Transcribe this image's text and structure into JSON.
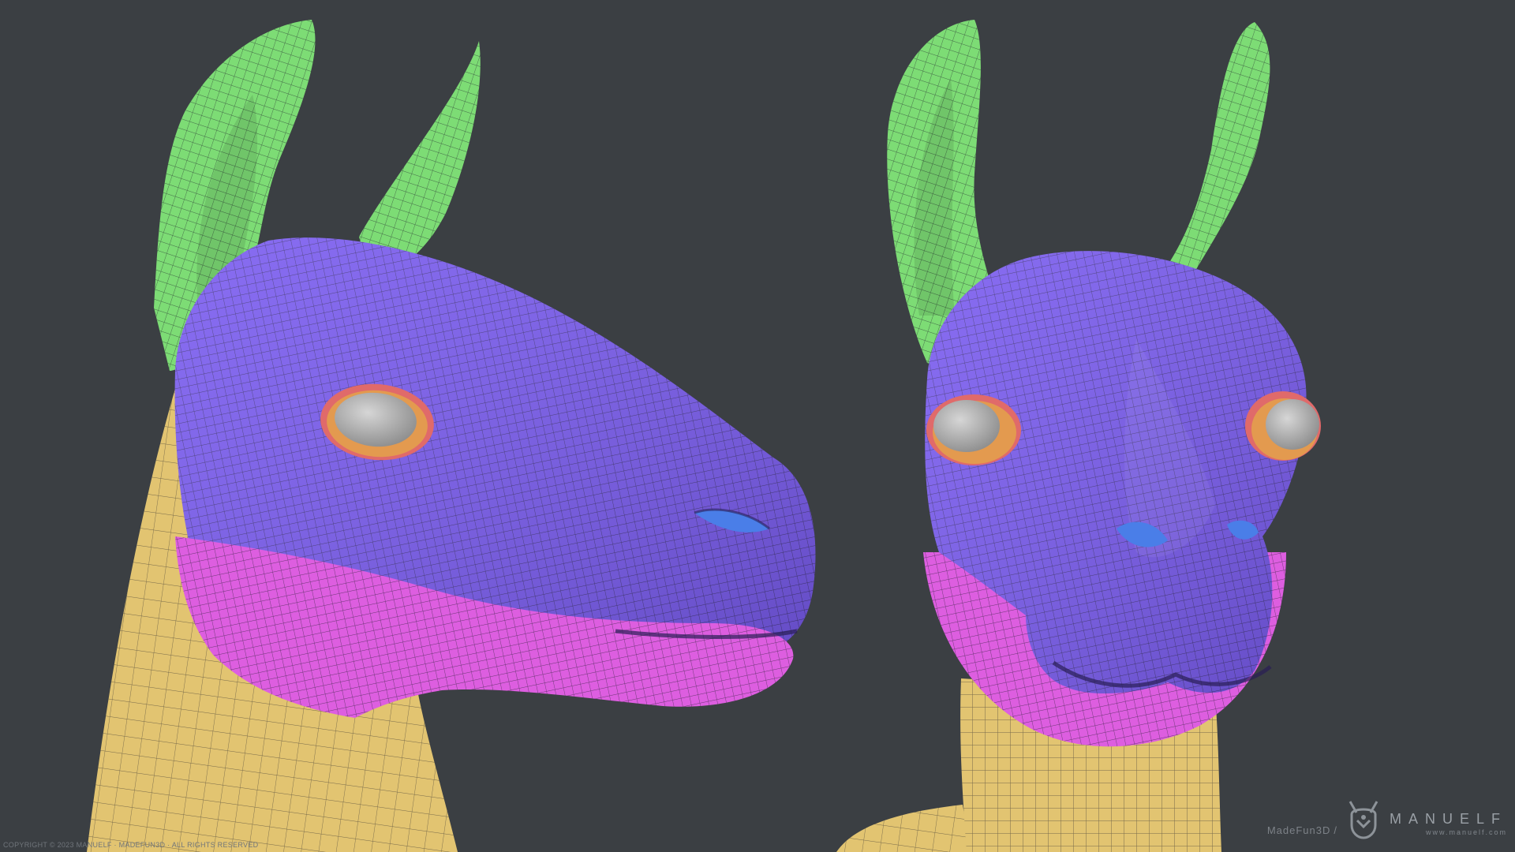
{
  "scene": {
    "background": "#3b3f43",
    "polygroup_colors": {
      "ears": "#7ddc75",
      "head": "#7a5cf0",
      "jaw": "#dd5ee0",
      "neck": "#e2c471",
      "eyeball": "#b3b3b3",
      "eyelid_outer": "#e06a6a",
      "eyelid_inner": "#e39a4f",
      "nostril": "#4a7ee8",
      "wireframe": "#1e1e2a"
    }
  },
  "watermark": {
    "copyright": "COPYRIGHT © 2023 MANUELF · MADEFUN3D · ALL RIGHTS RESERVED",
    "studio": "MadeFun3D",
    "separator": "/",
    "brand": "MANUELF",
    "url": "www.manuelf.com"
  }
}
